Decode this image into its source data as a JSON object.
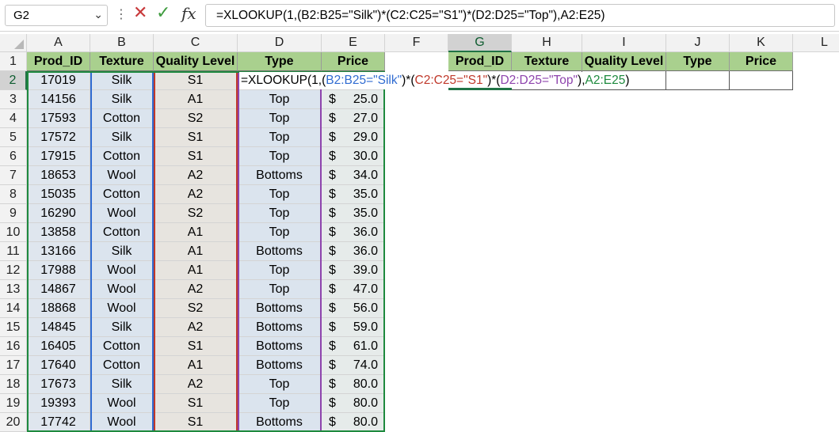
{
  "formula_bar": {
    "name_box": "G2",
    "formula": "=XLOOKUP(1,(B2:B25=\"Silk\")*(C2:C25=\"S1\")*(D2:D25=\"Top\"),A2:E25)",
    "icons": [
      "menu-dots-icon",
      "cancel-icon",
      "enter-check-icon",
      "fx-icon"
    ],
    "fx_label": "fx"
  },
  "columns": [
    "A",
    "B",
    "C",
    "D",
    "E",
    "F",
    "G",
    "H",
    "I",
    "J",
    "K",
    "L"
  ],
  "selected_column": "G",
  "selected_row": "2",
  "row_numbers": [
    "1",
    "2",
    "3",
    "4",
    "5",
    "6",
    "7",
    "8",
    "9",
    "10",
    "11",
    "12",
    "13",
    "14",
    "15",
    "16",
    "17",
    "18",
    "19",
    "20"
  ],
  "table": {
    "headers": [
      "Prod_ID",
      "Texture",
      "Quality Level",
      "Type",
      "Price"
    ],
    "rows": [
      [
        "17019",
        "Silk",
        "S1",
        "",
        ""
      ],
      [
        "14156",
        "Silk",
        "A1",
        "Top",
        "25.0"
      ],
      [
        "17593",
        "Cotton",
        "S2",
        "Top",
        "27.0"
      ],
      [
        "17572",
        "Silk",
        "S1",
        "Top",
        "29.0"
      ],
      [
        "17915",
        "Cotton",
        "S1",
        "Top",
        "30.0"
      ],
      [
        "18653",
        "Wool",
        "A2",
        "Bottoms",
        "34.0"
      ],
      [
        "15035",
        "Cotton",
        "A2",
        "Top",
        "35.0"
      ],
      [
        "16290",
        "Wool",
        "S2",
        "Top",
        "35.0"
      ],
      [
        "13858",
        "Cotton",
        "A1",
        "Top",
        "36.0"
      ],
      [
        "13166",
        "Silk",
        "A1",
        "Bottoms",
        "36.0"
      ],
      [
        "17988",
        "Wool",
        "A1",
        "Top",
        "39.0"
      ],
      [
        "14867",
        "Wool",
        "A2",
        "Top",
        "47.0"
      ],
      [
        "18868",
        "Wool",
        "S2",
        "Bottoms",
        "56.0"
      ],
      [
        "14845",
        "Silk",
        "A2",
        "Bottoms",
        "59.0"
      ],
      [
        "16405",
        "Cotton",
        "S1",
        "Bottoms",
        "61.0"
      ],
      [
        "17640",
        "Cotton",
        "A1",
        "Bottoms",
        "74.0"
      ],
      [
        "17673",
        "Silk",
        "A2",
        "Top",
        "80.0"
      ],
      [
        "19393",
        "Wool",
        "S1",
        "Top",
        "80.0"
      ],
      [
        "17742",
        "Wool",
        "S1",
        "Bottoms",
        "80.0"
      ]
    ],
    "currency_symbol": "$"
  },
  "lookup": {
    "headers": [
      "Prod_ID",
      "Texture",
      "Quality Level",
      "Type",
      "Price"
    ]
  },
  "editing_formula": {
    "p1": "=XLOOKUP(1,(",
    "p2": "B2:B25=\"Silk\"",
    "p3": ")*(",
    "p4": "C2:C25=\"S1\"",
    "p5": ")*(",
    "p6": "D2:D25=\"Top\"",
    "p7": "),",
    "p8": "A2:E25",
    "p9": ")"
  },
  "colors": {
    "header_fill": "#a9d08e",
    "range_b": "#2f6bd1",
    "range_c": "#c0392b",
    "range_d": "#8e44ad",
    "range_a": "#1e8a3e",
    "selected": "#217346"
  }
}
